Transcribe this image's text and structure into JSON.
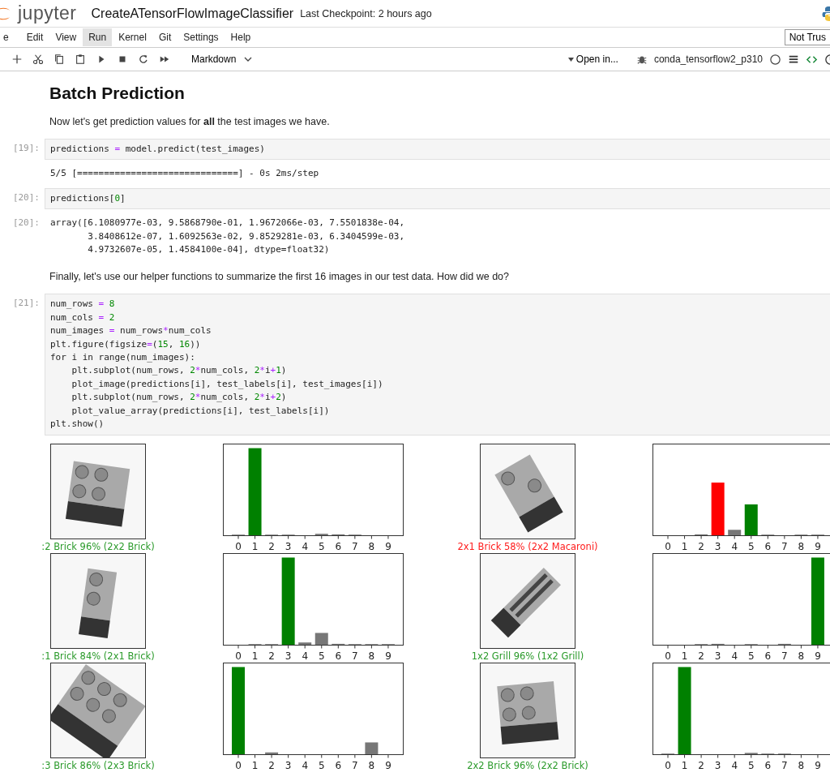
{
  "header": {
    "logo_text": "jupyter",
    "title": "CreateATensorFlowImageClassifier",
    "checkpoint": "Last Checkpoint: 2 hours ago"
  },
  "menu": [
    {
      "label": "e",
      "selected": false
    },
    {
      "label": "Edit",
      "selected": false
    },
    {
      "label": "View",
      "selected": false
    },
    {
      "label": "Run",
      "selected": true
    },
    {
      "label": "Kernel",
      "selected": false
    },
    {
      "label": "Git",
      "selected": false
    },
    {
      "label": "Settings",
      "selected": false
    },
    {
      "label": "Help",
      "selected": false
    }
  ],
  "trust_button": "Not Trus",
  "toolbar": {
    "cell_type": "Markdown",
    "open_in": "Open in...",
    "kernel": "conda_tensorflow2_p310"
  },
  "cells": [
    {
      "kind": "heading",
      "text": "Batch Prediction"
    },
    {
      "kind": "markdown",
      "text": "Now let's get prediction values for **all** the test images we have."
    },
    {
      "kind": "code",
      "prompt": "[19]:",
      "lines": [
        "predictions = model.predict(test_images)"
      ]
    },
    {
      "kind": "output",
      "lines": [
        "5/5 [==============================] - 0s 2ms/step"
      ]
    },
    {
      "kind": "code",
      "prompt": "[20]:",
      "lines": [
        "predictions[0]"
      ]
    },
    {
      "kind": "output",
      "prompt": "[20]:",
      "lines": [
        "array([6.1080977e-03, 9.5868790e-01, 1.9672066e-03, 7.5501838e-04,",
        "       3.8408612e-07, 1.6092563e-02, 9.8529281e-03, 6.3404599e-03,",
        "       4.9732607e-05, 1.4584100e-04], dtype=float32)"
      ]
    },
    {
      "kind": "markdown",
      "text": "Finally, let's use our helper functions to summarize the first 16 images in our test data. How did we do?"
    },
    {
      "kind": "code",
      "prompt": "[21]:",
      "lines": [
        "num_rows = 8",
        "num_cols = 2",
        "num_images = num_rows*num_cols",
        "plt.figure(figsize=(15, 16))",
        "for i in range(num_images):",
        "    plt.subplot(num_rows, 2*num_cols, 2*i+1)",
        "    plot_image(predictions[i], test_labels[i], test_images[i])",
        "    plt.subplot(num_rows, 2*num_cols, 2*i+2)",
        "    plot_value_array(predictions[i], test_labels[i])",
        "plt.show()"
      ]
    },
    {
      "kind": "plots",
      "items": [
        {
          "caption": ":2 Brick 96% (2x2 Brick)",
          "correct": true,
          "ticks": [
            "0",
            "1",
            "2",
            "3",
            "4",
            "5",
            "6",
            "7",
            "8",
            "9"
          ]
        },
        {
          "caption": "2x1 Brick 58% (2x2 Macaroni)",
          "correct": false,
          "ticks": [
            "0",
            "1",
            "2",
            "3",
            "4",
            "5",
            "6",
            "7",
            "8",
            "9"
          ]
        },
        {
          "caption": ":1 Brick 84% (2x1 Brick)",
          "correct": true,
          "ticks": [
            "0",
            "1",
            "2",
            "3",
            "4",
            "5",
            "6",
            "7",
            "8",
            "9"
          ]
        },
        {
          "caption": "1x2 Grill 96% (1x2 Grill)",
          "correct": true,
          "ticks": [
            "0",
            "1",
            "2",
            "3",
            "4",
            "5",
            "6",
            "7",
            "8",
            "9"
          ]
        },
        {
          "caption": ":3 Brick 86% (2x3 Brick)",
          "correct": true,
          "ticks": [
            "0",
            "1",
            "2",
            "3",
            "4",
            "5",
            "6",
            "7",
            "8",
            "9"
          ]
        },
        {
          "caption": "2x2 Brick 96% (2x2 Brick)",
          "correct": true,
          "ticks": [
            "0",
            "1",
            "2",
            "3",
            "4",
            "5",
            "6",
            "7",
            "8",
            "9"
          ]
        }
      ]
    }
  ]
}
